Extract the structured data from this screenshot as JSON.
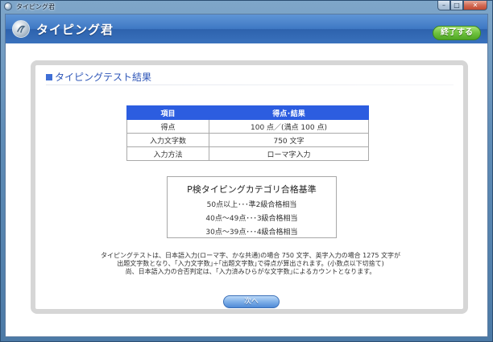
{
  "window": {
    "title": "タイピング君",
    "controls": {
      "minimize": "–",
      "maximize": "□",
      "close": "✕"
    }
  },
  "header": {
    "logo_icon": "typing-logo-icon",
    "title": "タイピング君",
    "quit_label": "終了する"
  },
  "section": {
    "title": "タイピングテスト結果"
  },
  "result_table": {
    "headers": [
      "項目",
      "得点･結果"
    ],
    "rows": [
      [
        "得点",
        "100 点／(満点 100 点)"
      ],
      [
        "入力文字数",
        "750 文字"
      ],
      [
        "入力方法",
        "ローマ字入力"
      ]
    ]
  },
  "criteria": {
    "title": "P検タイピングカテゴリ合格基準",
    "lines": [
      "50点以上･･･準2級合格相当",
      "40点～49点･･･3級合格相当",
      "30点～39点･･･4級合格相当"
    ]
  },
  "notes": [
    "タイピングテストは、日本語入力(ローマ字、かな共通)の場合 750 文字、英字入力の場合 1275 文字が",
    "出題文字数となり、｢入力文字数｣÷｢出題文字数｣で得点が算出されます。(小数点以下切捨て)",
    "尚、日本語入力の合否判定は、｢入力済みひらがな文字数｣によるカウントとなります。"
  ],
  "next_label": "次へ",
  "colors": {
    "header_blue": "#3e78c4",
    "table_header": "#2c5de0",
    "quit_green": "#6fc23e",
    "section_title": "#2e56b8"
  }
}
